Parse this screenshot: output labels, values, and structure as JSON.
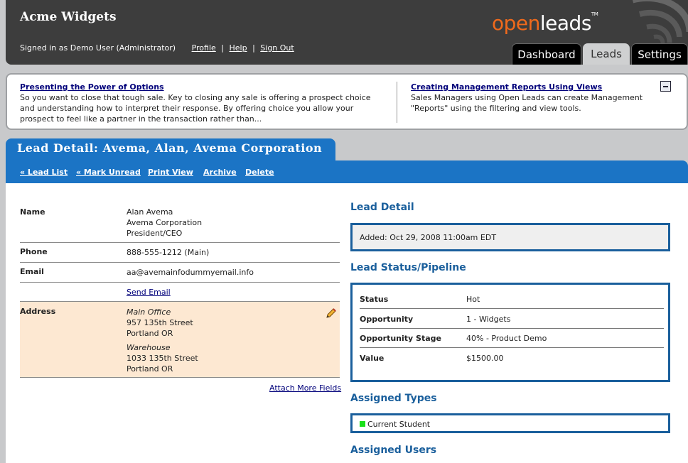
{
  "header": {
    "company": "Acme Widgets",
    "signed_in": "Signed in as Demo User (Administrator)",
    "links": {
      "profile": "Profile",
      "help": "Help",
      "sign_out": "Sign Out"
    },
    "separator": "|",
    "logo": {
      "open": "open",
      "leads": "leads",
      "tm": "TM"
    },
    "tabs": {
      "dashboard": "Dashboard",
      "leads": "Leads",
      "settings": "Settings"
    }
  },
  "tips": {
    "left": {
      "title": "Presenting the Power of Options",
      "text": "So you want to close that tough sale. Key to closing any sale is offering a prospect choice and understanding how to interpret their response. By offering choice you allow your prospect to feel like a partner in the transaction rather than..."
    },
    "right": {
      "title": "Creating Management Reports Using Views",
      "text": "Sales Managers using Open Leads can create Management \"Reports\" using the filtering and view tools."
    }
  },
  "lead": {
    "title": "Lead Detail: Avema, Alan, Avema Corporation",
    "actions": {
      "lead_list": "« Lead List",
      "mark_unread": "« Mark Unread",
      "print_view": "Print View",
      "archive": "Archive",
      "delete": "Delete"
    },
    "fields": {
      "name_label": "Name",
      "name": "Alan Avema",
      "company": "Avema Corporation",
      "position": "President/CEO",
      "phone_label": "Phone",
      "phone": "888-555-1212 (Main)",
      "email_label": "Email",
      "email": "aa@avemainfodummyemail.info",
      "send_email": "Send Email",
      "address_label": "Address",
      "addr1_type": "Main Office",
      "addr1_street": "957 135th Street",
      "addr1_city": "Portland OR",
      "addr2_type": "Warehouse",
      "addr2_street": "1033 135th Street",
      "addr2_city": "Portland OR",
      "attach_more": "Attach More Fields"
    },
    "detail": {
      "title": "Lead Detail",
      "added": "Added: Oct 29, 2008 11:00am EDT"
    },
    "status": {
      "title": "Lead Status/Pipeline",
      "rows": [
        {
          "k": "Status",
          "v": "Hot"
        },
        {
          "k": "Opportunity",
          "v": "1 - Widgets"
        },
        {
          "k": "Opportunity Stage",
          "v": "40% - Product Demo"
        },
        {
          "k": "Value",
          "v": "$1500.00"
        }
      ]
    },
    "types": {
      "title": "Assigned Types",
      "item": "Current Student",
      "item_color": "#18e018"
    },
    "users": {
      "title": "Assigned Users"
    }
  }
}
